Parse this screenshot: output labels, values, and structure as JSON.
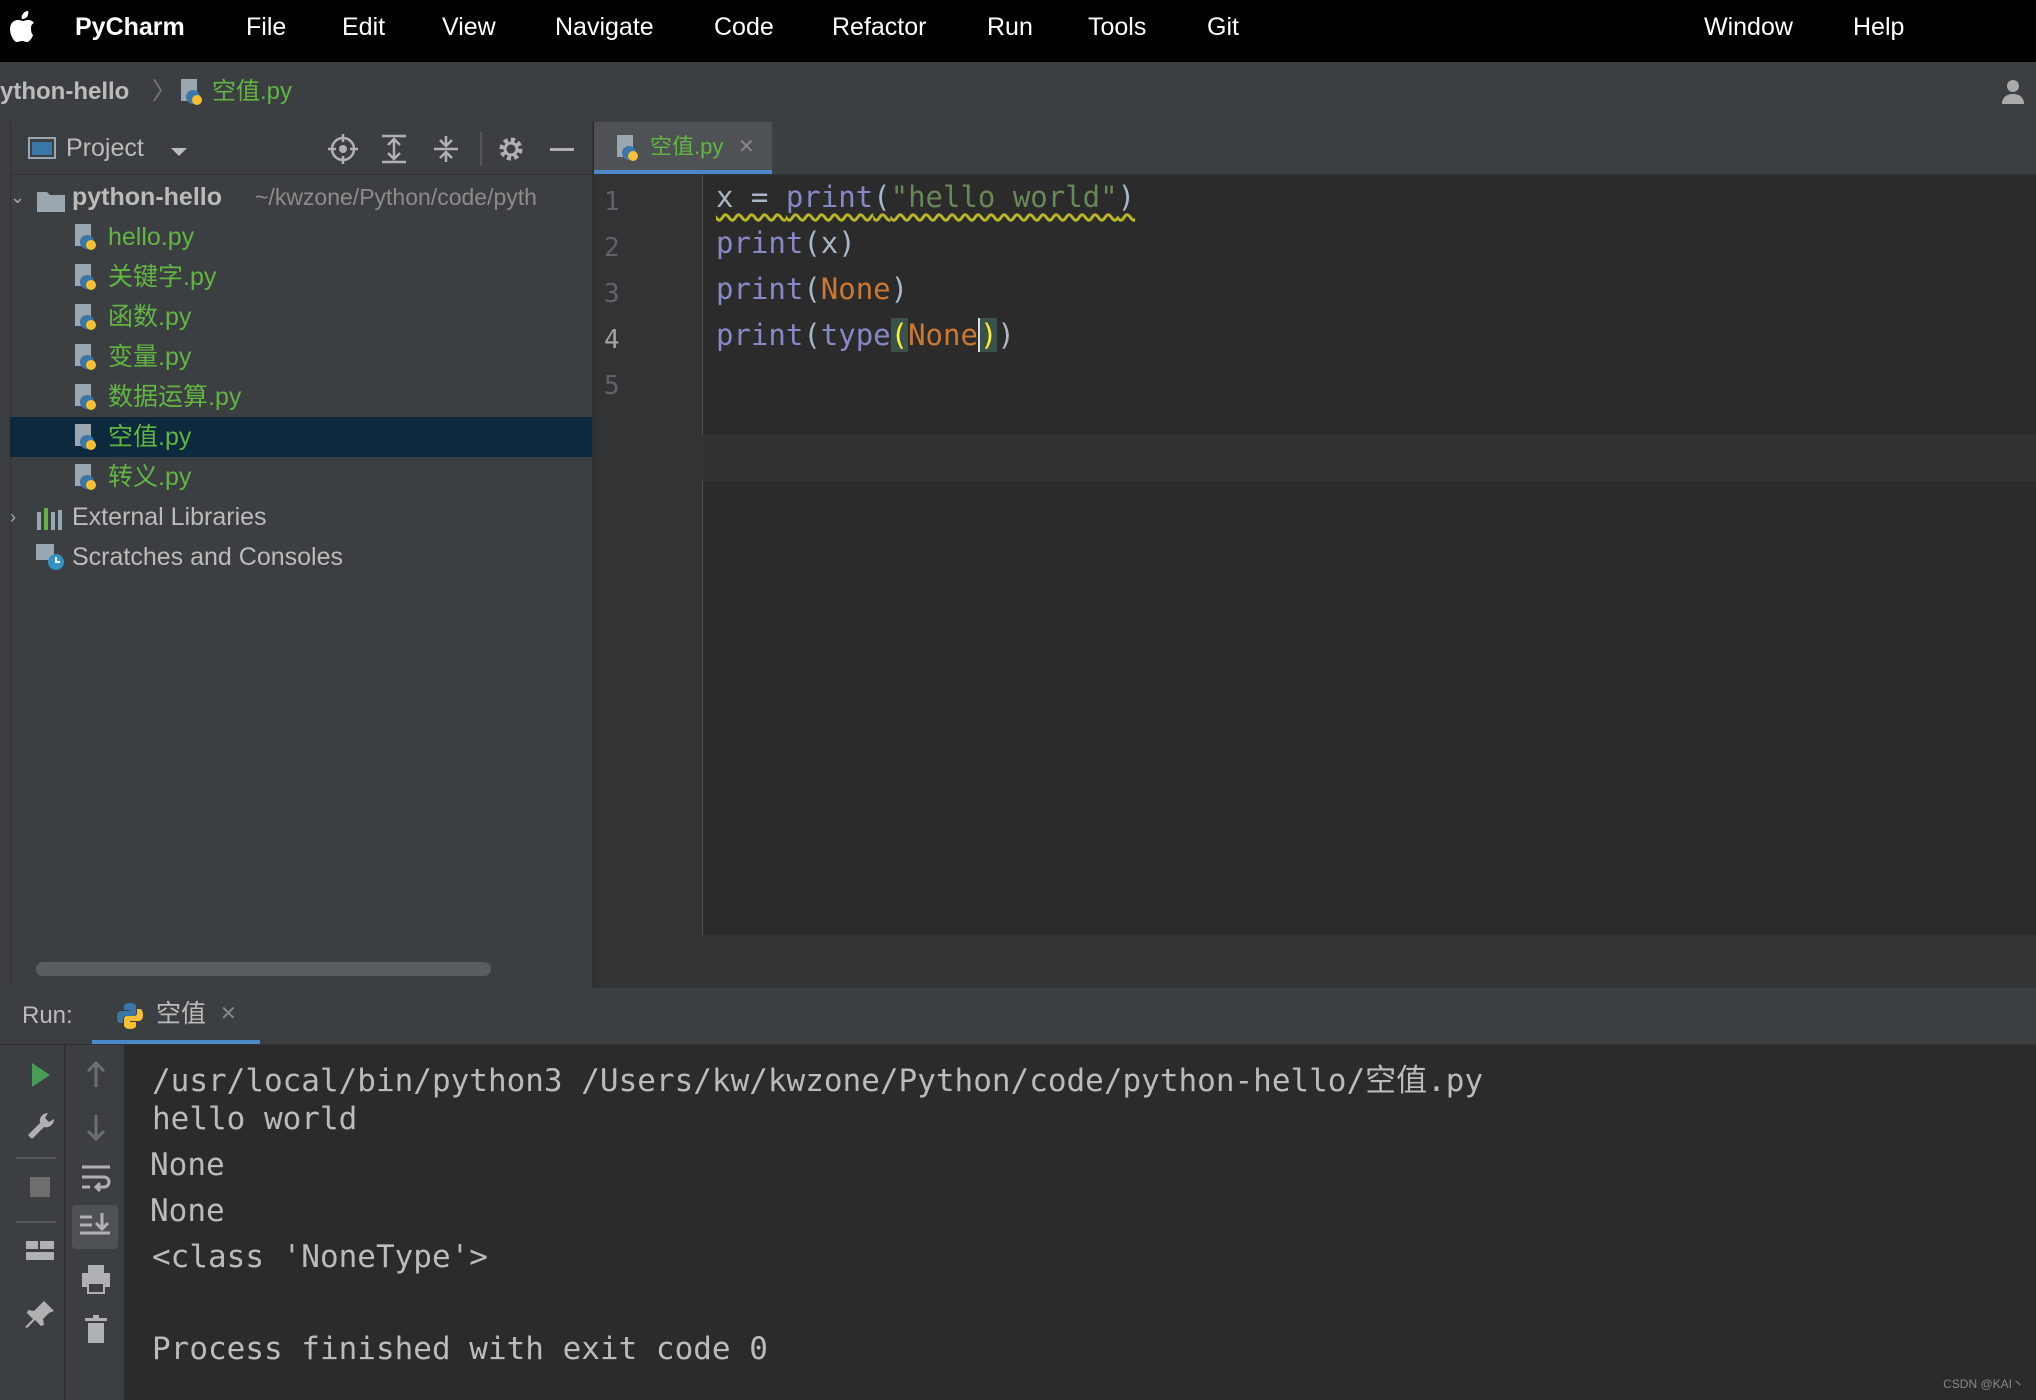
{
  "menubar": {
    "app_name": "PyCharm",
    "items": [
      "File",
      "Edit",
      "View",
      "Navigate",
      "Code",
      "Refactor",
      "Run",
      "Tools",
      "Git",
      "Window",
      "Help"
    ]
  },
  "navbar": {
    "project": "ython-hello",
    "separator": "〉",
    "file": "空值.py"
  },
  "project_panel": {
    "title": "Project",
    "root_name": "python-hello",
    "root_path": "~/kwzone/Python/code/pyth",
    "files": [
      "hello.py",
      "关键字.py",
      "函数.py",
      "变量.py",
      "数据运算.py",
      "空值.py",
      "转义.py"
    ],
    "selected_file": "空值.py",
    "external_libraries": "External Libraries",
    "scratches": "Scratches and Consoles"
  },
  "editor": {
    "tab_label": "空值.py",
    "close_glyph": "✕",
    "line_numbers": [
      "1",
      "2",
      "3",
      "4",
      "5"
    ],
    "current_line": "4",
    "code": {
      "l1_var": "x = ",
      "l1_fn": "print",
      "l1_open": "(",
      "l1_str": "\"hello world\"",
      "l1_close": ")",
      "l2_fn": "print",
      "l2_rest": "(x)",
      "l3_fn": "print",
      "l3_open": "(",
      "l3_none": "None",
      "l3_close": ")",
      "l4_fn": "print",
      "l4_open": "(",
      "l4_fn2": "type",
      "l4_open2": "(",
      "l4_none": "None",
      "l4_close2": ")",
      "l4_close": ")"
    }
  },
  "run_panel": {
    "label": "Run:",
    "tab_label": "空值",
    "close_glyph": "✕",
    "console_lines": [
      "/usr/local/bin/python3 /Users/kw/kwzone/Python/code/python-hello/空值.py",
      "hello world",
      "None",
      "None",
      "<class 'NoneType'>",
      "",
      "Process finished with exit code 0"
    ]
  },
  "watermark": "CSDN @KAI丶",
  "colors": {
    "background": "#2b2b2b",
    "panel": "#3c3f41",
    "selection": "#0d293e",
    "python_file": "#62b543",
    "keyword_builtin": "#8888c6",
    "none_keyword": "#cc7832",
    "string": "#6a8759",
    "run_green": "#499c54"
  }
}
